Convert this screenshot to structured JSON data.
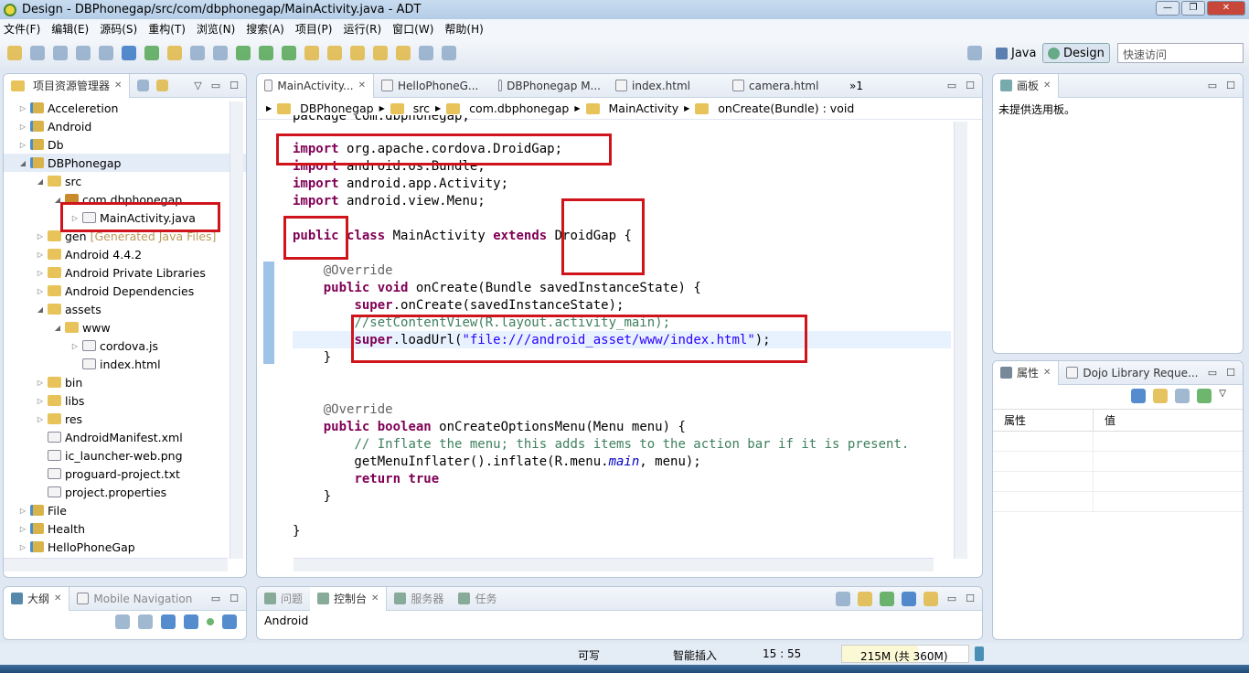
{
  "window": {
    "title": "Design  -  DBPhonegap/src/com/dbphonegap/MainActivity.java  -  ADT",
    "min": "—",
    "max": "❐",
    "close": "✕"
  },
  "menu": [
    "文件(F)",
    "编辑(E)",
    "源码(S)",
    "重构(T)",
    "浏览(N)",
    "搜索(A)",
    "项目(P)",
    "运行(R)",
    "窗口(W)",
    "帮助(H)"
  ],
  "perspectives": {
    "java": "Java",
    "design": "Design"
  },
  "quick_access": {
    "placeholder": "快速访问"
  },
  "explorer": {
    "title": "项目资源管理器",
    "items": [
      {
        "label": "Acceleretion",
        "level": 0,
        "icon": "project",
        "tw": "▷"
      },
      {
        "label": "Android",
        "level": 0,
        "icon": "project",
        "tw": "▷"
      },
      {
        "label": "Db",
        "level": 0,
        "icon": "project",
        "tw": "▷"
      },
      {
        "label": "DBPhonegap",
        "level": 0,
        "icon": "project",
        "tw": "◢",
        "selected": true
      },
      {
        "label": "src",
        "level": 1,
        "icon": "src-folder",
        "tw": "◢"
      },
      {
        "label": "com.dbphonegap",
        "level": 2,
        "icon": "package",
        "tw": "◢"
      },
      {
        "label": "MainActivity.java",
        "level": 3,
        "icon": "java-file",
        "tw": "▷"
      },
      {
        "label": "gen",
        "extra": "[Generated Java Files]",
        "level": 1,
        "icon": "src-folder",
        "tw": "▷"
      },
      {
        "label": "Android 4.4.2",
        "level": 1,
        "icon": "library",
        "tw": "▷"
      },
      {
        "label": "Android Private Libraries",
        "level": 1,
        "icon": "library",
        "tw": "▷"
      },
      {
        "label": "Android Dependencies",
        "level": 1,
        "icon": "library",
        "tw": "▷"
      },
      {
        "label": "assets",
        "level": 1,
        "icon": "folder",
        "tw": "◢"
      },
      {
        "label": "www",
        "level": 2,
        "icon": "folder",
        "tw": "◢"
      },
      {
        "label": "cordova.js",
        "level": 3,
        "icon": "file",
        "tw": "▷"
      },
      {
        "label": "index.html",
        "level": 3,
        "icon": "file",
        "tw": ""
      },
      {
        "label": "bin",
        "level": 1,
        "icon": "folder",
        "tw": "▷"
      },
      {
        "label": "libs",
        "level": 1,
        "icon": "folder",
        "tw": "▷"
      },
      {
        "label": "res",
        "level": 1,
        "icon": "folder",
        "tw": "▷"
      },
      {
        "label": "AndroidManifest.xml",
        "level": 1,
        "icon": "file",
        "tw": ""
      },
      {
        "label": "ic_launcher-web.png",
        "level": 1,
        "icon": "file",
        "tw": ""
      },
      {
        "label": "proguard-project.txt",
        "level": 1,
        "icon": "file",
        "tw": ""
      },
      {
        "label": "project.properties",
        "level": 1,
        "icon": "file",
        "tw": ""
      },
      {
        "label": "File",
        "level": 0,
        "icon": "project",
        "tw": "▷"
      },
      {
        "label": "Health",
        "level": 0,
        "icon": "project",
        "tw": "▷"
      },
      {
        "label": "HelloPhoneGap",
        "level": 0,
        "icon": "project",
        "tw": "▷"
      }
    ]
  },
  "editor": {
    "tabs": [
      "MainActivity...",
      "HelloPhoneG...",
      "DBPhonegap M...",
      "index.html",
      "camera.html"
    ],
    "overflow": "»1",
    "breadcrumb": [
      "DBPhonegap",
      "src",
      "com.dbphonegap",
      "MainActivity",
      "onCreate(Bundle) : void"
    ],
    "lines": [
      [
        [
          "",
          "package com.dbphonegap;"
        ]
      ],
      [
        [
          "kw",
          "import"
        ],
        [
          "",
          " org.apache.cordova.DroidGap;"
        ]
      ],
      [
        [
          "kw",
          "import"
        ],
        [
          "",
          " android.os.Bundle;"
        ]
      ],
      [
        [
          "kw",
          "import"
        ],
        [
          "",
          " android.app.Activity;"
        ]
      ],
      [
        [
          "kw",
          "import"
        ],
        [
          "",
          " android.view.Menu;"
        ]
      ],
      [],
      [
        [
          "kw",
          "public"
        ],
        [
          "",
          " "
        ],
        [
          "kw",
          "class"
        ],
        [
          "",
          " MainActivity "
        ],
        [
          "kw",
          "extends"
        ],
        [
          "",
          " DroidGap {"
        ]
      ],
      [],
      [
        [
          "",
          "    "
        ],
        [
          "an",
          "@Override"
        ]
      ],
      [
        [
          "",
          "    "
        ],
        [
          "kw",
          "public"
        ],
        [
          "",
          " "
        ],
        [
          "kw",
          "void"
        ],
        [
          "",
          " onCreate(Bundle savedInstanceState) {"
        ]
      ],
      [
        [
          "",
          "        "
        ],
        [
          "kw",
          "super"
        ],
        [
          "",
          ".onCreate(savedInstanceState);"
        ]
      ],
      [
        [
          "",
          "        "
        ],
        [
          "cm",
          "//setContentView(R.layout.activity_main);"
        ]
      ],
      [
        [
          "",
          "        "
        ],
        [
          "kw",
          "super"
        ],
        [
          "",
          ".loadUrl("
        ],
        [
          "str",
          "\"file:///android_asset/www/index.html\""
        ],
        [
          "",
          ");"
        ]
      ],
      [
        [
          "",
          "    }"
        ]
      ],
      [],
      [],
      [
        [
          "",
          "    "
        ],
        [
          "an",
          "@Override"
        ]
      ],
      [
        [
          "",
          "    "
        ],
        [
          "kw",
          "public"
        ],
        [
          "",
          " "
        ],
        [
          "kw",
          "boolean"
        ],
        [
          "",
          " onCreateOptionsMenu(Menu menu) {"
        ]
      ],
      [
        [
          "",
          "        "
        ],
        [
          "cm",
          "// Inflate the menu; this adds items to the action bar if it is present."
        ]
      ],
      [
        [
          "",
          "        getMenuInflater().inflate(R.menu."
        ],
        [
          "it",
          "main"
        ],
        [
          "",
          ", menu);"
        ]
      ],
      [
        [
          "",
          "        "
        ],
        [
          "kw",
          "return"
        ],
        [
          "",
          " "
        ],
        [
          "kw",
          "true"
        ],
        [
          ";"
        ]
      ],
      [
        [
          "",
          "    }"
        ]
      ],
      [],
      [
        [
          "",
          "}"
        ]
      ]
    ]
  },
  "palette": {
    "title": "画板",
    "empty": "未提供选用板。"
  },
  "properties": {
    "tabs": [
      "属性",
      "Dojo Library Reque..."
    ],
    "columns": [
      "属性",
      "值"
    ]
  },
  "outline": {
    "tabs": [
      "大纲",
      "Mobile Navigation"
    ]
  },
  "console": {
    "tabs": [
      "问题",
      "控制台",
      "服务器",
      "任务"
    ],
    "content": "Android"
  },
  "status": {
    "writable": "可写",
    "insert": "智能插入",
    "position": "15 : 55",
    "heap": "215M (共 360M)",
    "heap_used_fraction": 0.6
  },
  "colors": {
    "highlight": "#d0141c",
    "keyword": "#7f0055",
    "string": "#2a00ff",
    "comment": "#3f7f5f"
  }
}
